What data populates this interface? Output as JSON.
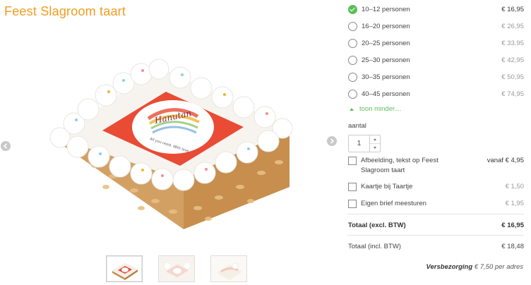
{
  "product": {
    "title": "Feest Slagroom taart"
  },
  "sizes": [
    {
      "label": "10–12 personen",
      "price": "€ 16,95",
      "selected": true
    },
    {
      "label": "16–20 personen",
      "price": "€ 26,95",
      "selected": false
    },
    {
      "label": "20–25 personen",
      "price": "€ 33,95",
      "selected": false
    },
    {
      "label": "25–30 personen",
      "price": "€ 42,95",
      "selected": false
    },
    {
      "label": "30–35 personen",
      "price": "€ 50,95",
      "selected": false
    },
    {
      "label": "40–45 personen",
      "price": "€ 74,95",
      "selected": false
    }
  ],
  "toon_minder": "toon minder…",
  "quantity": {
    "label": "aantal",
    "value": "1"
  },
  "options": [
    {
      "label": "Afbeelding, tekst op Feest Slagroom taart",
      "price": "vanaf € 4,95"
    },
    {
      "label": "Kaartje bij Taartje",
      "price": "€ 1,50"
    },
    {
      "label": "Eigen brief meesturen",
      "price": "€ 1,95"
    }
  ],
  "totals": {
    "excl_label": "Totaal (excl. BTW)",
    "excl_value": "€ 16,95",
    "incl_label": "Totaal (incl. BTW)",
    "incl_value": "€ 18,48"
  },
  "shipping": {
    "label": "Versbezorging",
    "value": "€ 7,50 per adres"
  },
  "hero_logo_text": "Hanutan",
  "hero_tagline": "All you need. With love.",
  "colors": {
    "brand_orange": "#f29c1f",
    "check_green": "#5bbf5a",
    "cake_red": "#e94b35"
  }
}
